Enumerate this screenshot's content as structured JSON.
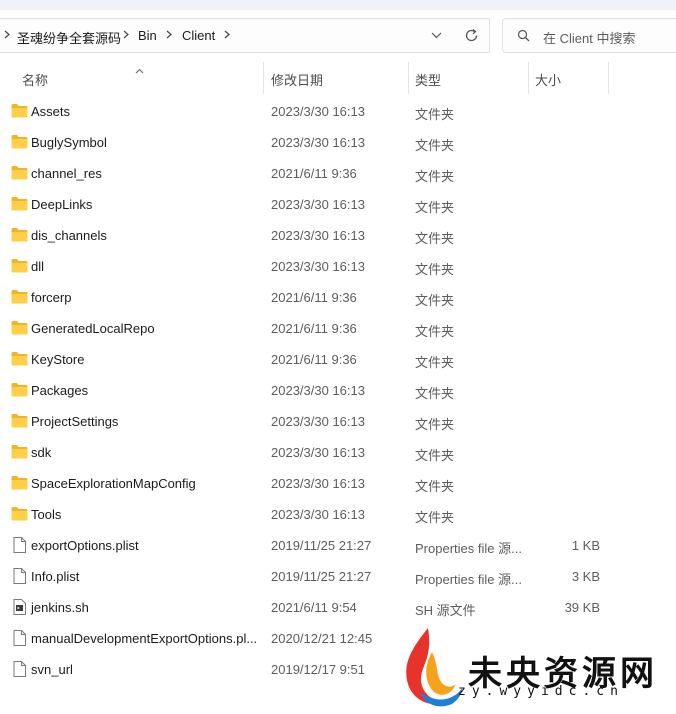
{
  "breadcrumb": [
    "圣魂纷争全套源码",
    "Bin",
    "Client"
  ],
  "search": {
    "placeholder": "在 Client 中搜索"
  },
  "columns": {
    "name": "名称",
    "modified": "修改日期",
    "type": "类型",
    "size": "大小"
  },
  "files": [
    {
      "name": "Assets",
      "modified": "2023/3/30 16:13",
      "type": "文件夹",
      "size": "",
      "icon": "folder-icon"
    },
    {
      "name": "BuglySymbol",
      "modified": "2023/3/30 16:13",
      "type": "文件夹",
      "size": "",
      "icon": "folder-icon"
    },
    {
      "name": "channel_res",
      "modified": "2021/6/11 9:36",
      "type": "文件夹",
      "size": "",
      "icon": "folder-icon"
    },
    {
      "name": "DeepLinks",
      "modified": "2023/3/30 16:13",
      "type": "文件夹",
      "size": "",
      "icon": "folder-icon"
    },
    {
      "name": "dis_channels",
      "modified": "2023/3/30 16:13",
      "type": "文件夹",
      "size": "",
      "icon": "folder-icon"
    },
    {
      "name": "dll",
      "modified": "2023/3/30 16:13",
      "type": "文件夹",
      "size": "",
      "icon": "folder-icon"
    },
    {
      "name": "forcerp",
      "modified": "2021/6/11 9:36",
      "type": "文件夹",
      "size": "",
      "icon": "folder-icon"
    },
    {
      "name": "GeneratedLocalRepo",
      "modified": "2021/6/11 9:36",
      "type": "文件夹",
      "size": "",
      "icon": "folder-icon"
    },
    {
      "name": "KeyStore",
      "modified": "2021/6/11 9:36",
      "type": "文件夹",
      "size": "",
      "icon": "folder-icon"
    },
    {
      "name": "Packages",
      "modified": "2023/3/30 16:13",
      "type": "文件夹",
      "size": "",
      "icon": "folder-icon"
    },
    {
      "name": "ProjectSettings",
      "modified": "2023/3/30 16:13",
      "type": "文件夹",
      "size": "",
      "icon": "folder-icon"
    },
    {
      "name": "sdk",
      "modified": "2023/3/30 16:13",
      "type": "文件夹",
      "size": "",
      "icon": "folder-icon"
    },
    {
      "name": "SpaceExplorationMapConfig",
      "modified": "2023/3/30 16:13",
      "type": "文件夹",
      "size": "",
      "icon": "folder-icon"
    },
    {
      "name": "Tools",
      "modified": "2023/3/30 16:13",
      "type": "文件夹",
      "size": "",
      "icon": "folder-icon"
    },
    {
      "name": "exportOptions.plist",
      "modified": "2019/11/25 21:27",
      "type": "Properties file 源...",
      "size": "1 KB",
      "icon": "file-icon"
    },
    {
      "name": "Info.plist",
      "modified": "2019/11/25 21:27",
      "type": "Properties file 源...",
      "size": "3 KB",
      "icon": "file-icon"
    },
    {
      "name": "jenkins.sh",
      "modified": "2021/6/11 9:54",
      "type": "SH 源文件",
      "size": "39 KB",
      "icon": "script-file-icon"
    },
    {
      "name": "manualDevelopmentExportOptions.pl...",
      "modified": "2020/12/21 12:45",
      "type": "",
      "size": "",
      "icon": "file-icon"
    },
    {
      "name": "svn_url",
      "modified": "2019/12/17 9:51",
      "type": "",
      "size": "",
      "icon": "file-icon"
    }
  ],
  "watermark": {
    "title": "未央资源网",
    "url": "zy.wyyidc.cn"
  }
}
